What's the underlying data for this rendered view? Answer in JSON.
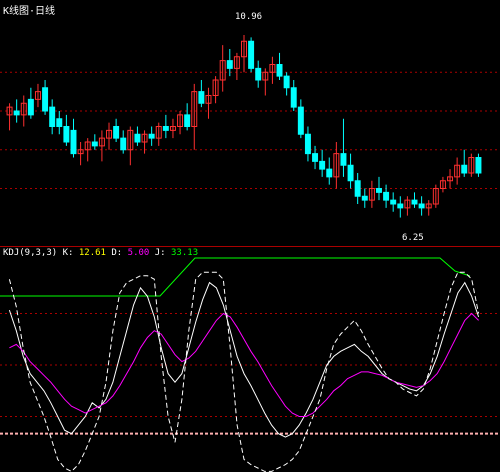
{
  "header": {
    "title": "K线图·日线",
    "title_color": "#ffffff"
  },
  "indicator_header": {
    "segments": [
      {
        "text": "KDJ(9,3,3)",
        "color": "#ffffff"
      },
      {
        "text": "K:",
        "color": "#ffffff"
      },
      {
        "text": "12.61",
        "color": "#ffff00"
      },
      {
        "text": "D:",
        "color": "#ffffff"
      },
      {
        "text": "5.00",
        "color": "#ff00ff"
      },
      {
        "text": "J:",
        "color": "#ffffff"
      },
      {
        "text": "33.13",
        "color": "#00ff00"
      }
    ]
  },
  "annotations": {
    "high_price": "10.96",
    "low_price": "6.25",
    "high_color": "#ffffff",
    "low_color": "#ffffff"
  },
  "colors": {
    "up": "#ff3030",
    "down": "#00ffff",
    "grid": "#aa0000",
    "k_line": "#ffffff",
    "d_line": "#ff00ff",
    "j_line": "#ffffff",
    "top_band": "#00ff00",
    "baseline": "#ffb0b0"
  },
  "chart_data": [
    {
      "type": "candlestick",
      "title": "",
      "ylim": [
        5.8,
        11.4
      ],
      "candles": [
        {
          "o": 8.9,
          "h": 9.2,
          "l": 8.5,
          "c": 9.1
        },
        {
          "o": 9.0,
          "h": 9.3,
          "l": 8.7,
          "c": 8.9
        },
        {
          "o": 8.9,
          "h": 9.4,
          "l": 8.6,
          "c": 9.2
        },
        {
          "o": 9.3,
          "h": 9.6,
          "l": 8.8,
          "c": 8.9
        },
        {
          "o": 9.3,
          "h": 9.7,
          "l": 9.1,
          "c": 9.5
        },
        {
          "o": 9.6,
          "h": 9.8,
          "l": 8.9,
          "c": 9.0
        },
        {
          "o": 9.1,
          "h": 9.3,
          "l": 8.4,
          "c": 8.6
        },
        {
          "o": 8.8,
          "h": 9.0,
          "l": 8.4,
          "c": 8.6
        },
        {
          "o": 8.6,
          "h": 8.9,
          "l": 8.1,
          "c": 8.2
        },
        {
          "o": 8.5,
          "h": 8.8,
          "l": 7.8,
          "c": 7.9
        },
        {
          "o": 7.9,
          "h": 8.2,
          "l": 7.6,
          "c": 8.0
        },
        {
          "o": 8.0,
          "h": 8.3,
          "l": 7.7,
          "c": 8.2
        },
        {
          "o": 8.2,
          "h": 8.4,
          "l": 8.0,
          "c": 8.1
        },
        {
          "o": 8.1,
          "h": 8.5,
          "l": 7.7,
          "c": 8.3
        },
        {
          "o": 8.3,
          "h": 8.7,
          "l": 8.0,
          "c": 8.5
        },
        {
          "o": 8.6,
          "h": 8.8,
          "l": 8.2,
          "c": 8.3
        },
        {
          "o": 8.3,
          "h": 8.5,
          "l": 7.9,
          "c": 8.0
        },
        {
          "o": 8.0,
          "h": 8.6,
          "l": 7.6,
          "c": 8.5
        },
        {
          "o": 8.4,
          "h": 8.6,
          "l": 8.1,
          "c": 8.2
        },
        {
          "o": 8.2,
          "h": 8.5,
          "l": 7.9,
          "c": 8.4
        },
        {
          "o": 8.4,
          "h": 8.6,
          "l": 8.1,
          "c": 8.3
        },
        {
          "o": 8.3,
          "h": 8.7,
          "l": 8.1,
          "c": 8.6
        },
        {
          "o": 8.6,
          "h": 8.9,
          "l": 8.3,
          "c": 8.5
        },
        {
          "o": 8.5,
          "h": 8.8,
          "l": 8.3,
          "c": 8.6
        },
        {
          "o": 8.6,
          "h": 9.0,
          "l": 8.4,
          "c": 8.9
        },
        {
          "o": 8.9,
          "h": 9.2,
          "l": 8.5,
          "c": 8.6
        },
        {
          "o": 8.6,
          "h": 9.7,
          "l": 8.0,
          "c": 9.5
        },
        {
          "o": 9.5,
          "h": 9.8,
          "l": 9.1,
          "c": 9.2
        },
        {
          "o": 9.2,
          "h": 9.6,
          "l": 8.8,
          "c": 9.4
        },
        {
          "o": 9.4,
          "h": 9.9,
          "l": 9.2,
          "c": 9.8
        },
        {
          "o": 9.8,
          "h": 10.7,
          "l": 9.5,
          "c": 10.3
        },
        {
          "o": 10.3,
          "h": 10.6,
          "l": 9.9,
          "c": 10.1
        },
        {
          "o": 10.1,
          "h": 10.5,
          "l": 9.8,
          "c": 10.4
        },
        {
          "o": 10.4,
          "h": 10.96,
          "l": 10.0,
          "c": 10.8
        },
        {
          "o": 10.8,
          "h": 10.9,
          "l": 10.0,
          "c": 10.1
        },
        {
          "o": 10.1,
          "h": 10.3,
          "l": 9.6,
          "c": 9.8
        },
        {
          "o": 9.8,
          "h": 10.1,
          "l": 9.4,
          "c": 10.0
        },
        {
          "o": 10.0,
          "h": 10.4,
          "l": 9.7,
          "c": 10.2
        },
        {
          "o": 10.2,
          "h": 10.5,
          "l": 9.8,
          "c": 9.9
        },
        {
          "o": 9.9,
          "h": 10.0,
          "l": 9.4,
          "c": 9.6
        },
        {
          "o": 9.6,
          "h": 9.8,
          "l": 9.0,
          "c": 9.1
        },
        {
          "o": 9.1,
          "h": 9.3,
          "l": 8.3,
          "c": 8.4
        },
        {
          "o": 8.4,
          "h": 8.6,
          "l": 7.7,
          "c": 7.9
        },
        {
          "o": 7.9,
          "h": 8.1,
          "l": 7.5,
          "c": 7.7
        },
        {
          "o": 7.7,
          "h": 8.0,
          "l": 7.3,
          "c": 7.5
        },
        {
          "o": 7.5,
          "h": 7.8,
          "l": 7.1,
          "c": 7.3
        },
        {
          "o": 7.3,
          "h": 8.2,
          "l": 7.0,
          "c": 7.9
        },
        {
          "o": 7.9,
          "h": 8.8,
          "l": 7.3,
          "c": 7.6
        },
        {
          "o": 7.6,
          "h": 7.9,
          "l": 7.0,
          "c": 7.2
        },
        {
          "o": 7.2,
          "h": 7.4,
          "l": 6.6,
          "c": 6.8
        },
        {
          "o": 6.8,
          "h": 7.0,
          "l": 6.5,
          "c": 6.7
        },
        {
          "o": 6.7,
          "h": 7.2,
          "l": 6.5,
          "c": 7.0
        },
        {
          "o": 7.0,
          "h": 7.3,
          "l": 6.7,
          "c": 6.9
        },
        {
          "o": 6.9,
          "h": 7.1,
          "l": 6.5,
          "c": 6.7
        },
        {
          "o": 6.7,
          "h": 6.9,
          "l": 6.4,
          "c": 6.6
        },
        {
          "o": 6.6,
          "h": 6.8,
          "l": 6.25,
          "c": 6.5
        },
        {
          "o": 6.5,
          "h": 6.8,
          "l": 6.3,
          "c": 6.7
        },
        {
          "o": 6.7,
          "h": 6.9,
          "l": 6.5,
          "c": 6.6
        },
        {
          "o": 6.6,
          "h": 6.8,
          "l": 6.3,
          "c": 6.5
        },
        {
          "o": 6.5,
          "h": 6.7,
          "l": 6.3,
          "c": 6.6
        },
        {
          "o": 6.6,
          "h": 7.1,
          "l": 6.5,
          "c": 7.0
        },
        {
          "o": 7.0,
          "h": 7.3,
          "l": 6.9,
          "c": 7.2
        },
        {
          "o": 7.2,
          "h": 7.5,
          "l": 7.0,
          "c": 7.3
        },
        {
          "o": 7.3,
          "h": 7.8,
          "l": 7.1,
          "c": 7.6
        },
        {
          "o": 7.6,
          "h": 8.0,
          "l": 7.3,
          "c": 7.4
        },
        {
          "o": 7.4,
          "h": 7.9,
          "l": 7.3,
          "c": 7.8
        },
        {
          "o": 7.8,
          "h": 7.9,
          "l": 7.3,
          "c": 7.4
        }
      ]
    },
    {
      "type": "line",
      "title": "",
      "ylim": [
        -10,
        110
      ],
      "series": [
        {
          "name": "K",
          "values": [
            82,
            70,
            55,
            45,
            40,
            35,
            28,
            20,
            12,
            10,
            15,
            20,
            28,
            25,
            30,
            40,
            55,
            70,
            85,
            95,
            90,
            78,
            60,
            45,
            40,
            45,
            60,
            75,
            88,
            98,
            95,
            85,
            70,
            55,
            45,
            38,
            30,
            22,
            15,
            10,
            8,
            10,
            15,
            22,
            30,
            40,
            50,
            55,
            58,
            60,
            62,
            58,
            55,
            50,
            45,
            42,
            40,
            38,
            36,
            35,
            38,
            45,
            55,
            68,
            80,
            92,
            98,
            90,
            78
          ]
        },
        {
          "name": "D",
          "values": [
            60,
            62,
            58,
            52,
            48,
            44,
            40,
            35,
            30,
            26,
            24,
            22,
            24,
            26,
            28,
            32,
            38,
            45,
            52,
            60,
            66,
            70,
            68,
            62,
            56,
            52,
            54,
            58,
            64,
            70,
            76,
            80,
            78,
            72,
            65,
            58,
            52,
            45,
            38,
            32,
            26,
            22,
            20,
            20,
            22,
            26,
            30,
            35,
            38,
            42,
            44,
            46,
            46,
            45,
            44,
            42,
            40,
            39,
            38,
            37,
            38,
            41,
            45,
            52,
            60,
            68,
            76,
            80,
            76
          ]
        },
        {
          "name": "J",
          "values": [
            100,
            84,
            60,
            40,
            30,
            20,
            8,
            -5,
            -10,
            -12,
            -8,
            0,
            10,
            20,
            40,
            70,
            92,
            98,
            100,
            102,
            102,
            100,
            55,
            20,
            5,
            30,
            70,
            100,
            104,
            104,
            104,
            100,
            60,
            15,
            -5,
            -8,
            -10,
            -12,
            -12,
            -10,
            -8,
            -5,
            0,
            10,
            20,
            30,
            48,
            62,
            68,
            72,
            76,
            70,
            62,
            55,
            48,
            42,
            40,
            36,
            34,
            32,
            36,
            48,
            64,
            80,
            95,
            104,
            104,
            100,
            80
          ]
        }
      ]
    }
  ]
}
